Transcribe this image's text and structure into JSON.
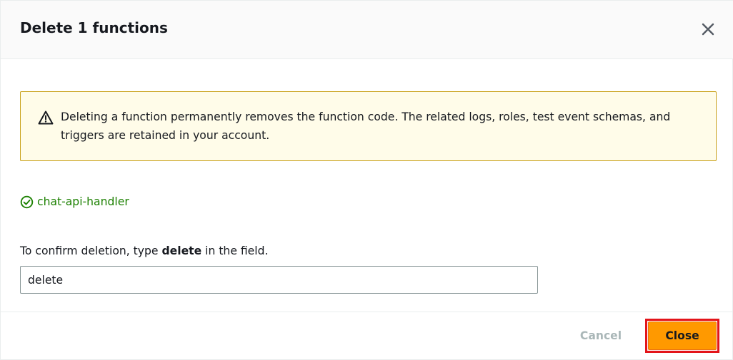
{
  "modal": {
    "title": "Delete 1 functions",
    "close_icon": "close-icon"
  },
  "warning": {
    "icon": "warning-icon",
    "text": "Deleting a function permanently removes the function code. The related logs, roles, test event schemas, and triggers are retained in your account."
  },
  "functions": [
    {
      "name": "chat-api-handler",
      "icon": "check-circle-icon"
    }
  ],
  "confirm": {
    "label_prefix": "To confirm deletion, type ",
    "label_keyword": "delete",
    "label_suffix": " in the field.",
    "value": "delete"
  },
  "footer": {
    "cancel_label": "Cancel",
    "close_label": "Close"
  },
  "colors": {
    "primary_button": "#ff9900",
    "success_text": "#1d8102",
    "warning_bg": "#fffce9",
    "warning_border": "#c9a11a",
    "highlight_outline": "#e3151a",
    "disabled_text": "#aab7b8"
  }
}
